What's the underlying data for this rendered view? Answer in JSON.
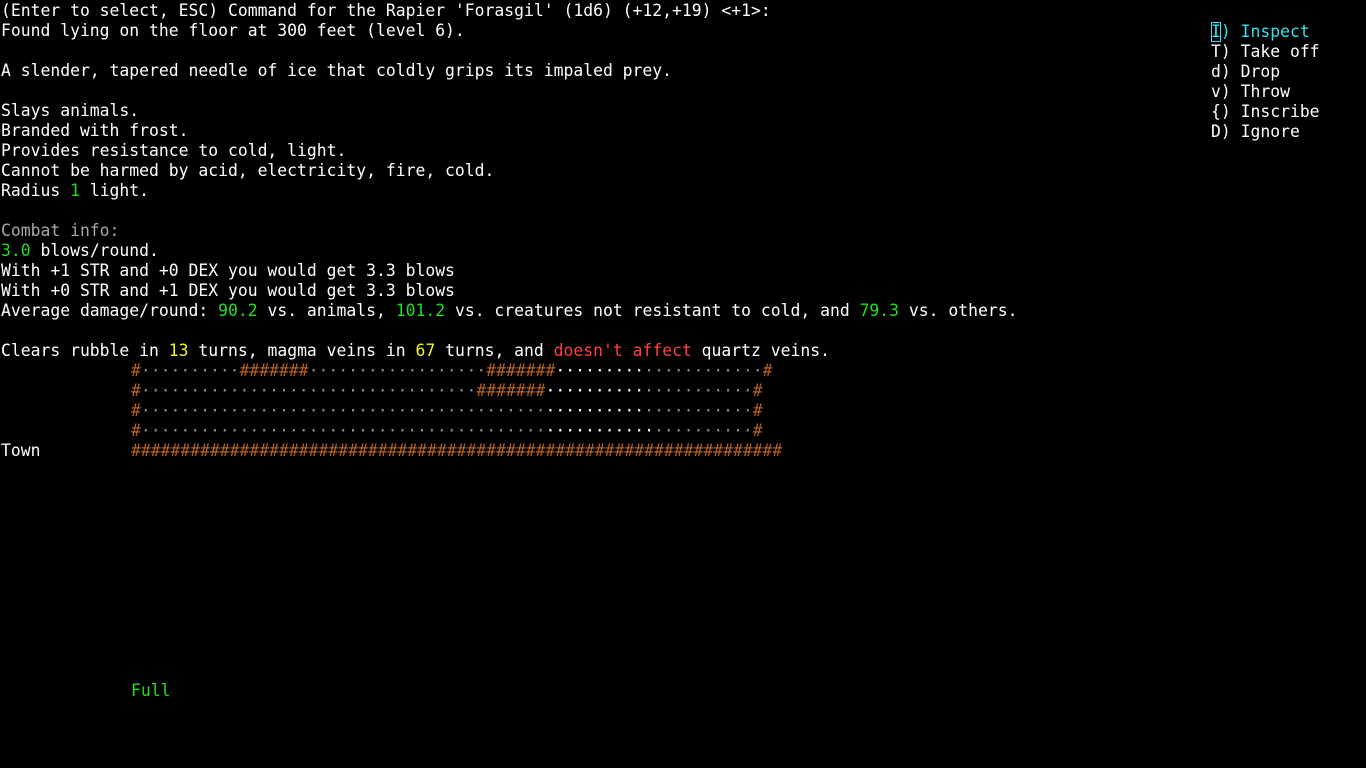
{
  "header": {
    "prompt": "(Enter to select, ESC) Command for the Rapier 'Forasgil' (1d6) (+12,+19) <+1>:",
    "found": "Found lying on the floor at 300 feet (level 6).",
    "description": "A slender, tapered needle of ice that coldly grips its impaled prey."
  },
  "properties": {
    "slays": "Slays animals.",
    "brand": "Branded with frost.",
    "resist": "Provides resistance to cold, light.",
    "harm": "Cannot be harmed by acid, electricity, fire, cold.",
    "radius_prefix": "Radius ",
    "radius_value": "1",
    "radius_suffix": " light."
  },
  "combat": {
    "heading": "Combat info:",
    "blows_value": "3.0",
    "blows_suffix": " blows/round.",
    "str_line": "With +1 STR and +0 DEX you would get 3.3 blows",
    "dex_line": "With +0 STR and +1 DEX you would get 3.3 blows",
    "dmg_prefix": "Average damage/round: ",
    "dmg_animals": "90.2",
    "dmg_mid1": " vs. animals, ",
    "dmg_cold": "101.2",
    "dmg_mid2": " vs. creatures not resistant to cold, and ",
    "dmg_others": "79.3",
    "dmg_suffix": " vs. others."
  },
  "digging": {
    "prefix": "Clears rubble in ",
    "rubble": "13",
    "mid1": " turns, magma veins in ",
    "magma": "67",
    "mid2": " turns, and ",
    "quartz": "doesn't affect",
    "suffix": " quartz veins."
  },
  "menu": {
    "items": [
      {
        "key": "I",
        "label": ") Inspect",
        "selected": true
      },
      {
        "key": "T",
        "label": ") Take off",
        "selected": false
      },
      {
        "key": "d",
        "label": ") Drop",
        "selected": false
      },
      {
        "key": "v",
        "label": ") Throw",
        "selected": false
      },
      {
        "key": "{",
        "label": ") Inscribe",
        "selected": false
      },
      {
        "key": "D",
        "label": ") Ignore",
        "selected": false
      }
    ]
  },
  "map": {
    "rows": [
      [
        [
          "brown",
          "#"
        ],
        [
          "dim",
          "··········"
        ],
        [
          "brown",
          "#######"
        ],
        [
          "dim",
          "··················"
        ],
        [
          "brown",
          "#######"
        ],
        [
          "bright",
          "·········"
        ],
        [
          "dim",
          "············"
        ],
        [
          "brown",
          "#"
        ]
      ],
      [
        [
          "brown",
          "#"
        ],
        [
          "dim",
          "··································"
        ],
        [
          "brown",
          "#######"
        ],
        [
          "bright",
          "··········"
        ],
        [
          "dim",
          "···········"
        ],
        [
          "brown",
          "#"
        ]
      ],
      [
        [
          "brown",
          "#"
        ],
        [
          "dim",
          "·········································"
        ],
        [
          "bright",
          "··········"
        ],
        [
          "dim",
          "···········"
        ],
        [
          "brown",
          "#"
        ]
      ],
      [
        [
          "brown",
          "#"
        ],
        [
          "dim",
          "·········································"
        ],
        [
          "bright",
          "···········"
        ],
        [
          "dim",
          "··········"
        ],
        [
          "brown",
          "#"
        ]
      ],
      [
        [
          "brown",
          "##################################################################"
        ]
      ]
    ],
    "location": "Town"
  },
  "status": {
    "full": "Full"
  },
  "colors": {
    "background": "#000000",
    "text": "#ffffff",
    "good": "#22dd22",
    "yellow": "#f2f22a",
    "red": "#ff4040",
    "grey": "#a8a8a8",
    "wall": "#b8621d",
    "menu_selected": "#38e0ec"
  }
}
